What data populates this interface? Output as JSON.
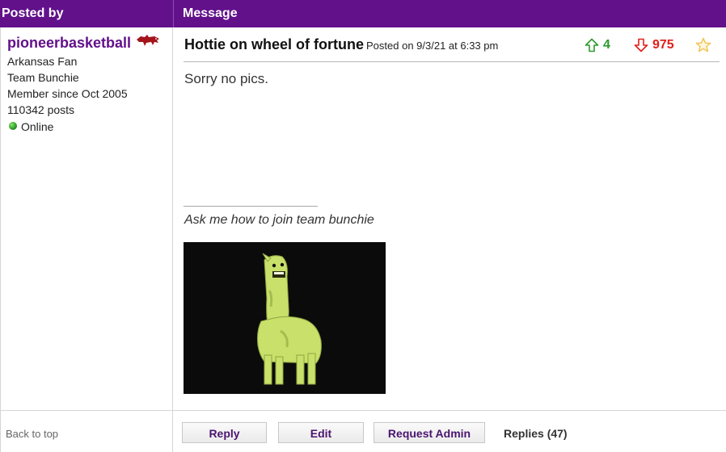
{
  "header": {
    "posted_by": "Posted by",
    "message": "Message"
  },
  "user": {
    "name": "pioneerbasketball",
    "fan": "Arkansas Fan",
    "team": "Team Bunchie",
    "member_since": "Member since Oct 2005",
    "posts": "110342 posts",
    "status": "Online",
    "status_color": "#2ea02a",
    "team_icon": "razorback-hog-icon"
  },
  "post": {
    "title": "Hottie on wheel of fortune",
    "posted_on": "Posted on 9/3/21 at 6:33 pm",
    "upvotes": "4",
    "downvotes": "975",
    "body": "Sorry no pics.",
    "signature_text": "Ask me how to join team bunchie"
  },
  "footer": {
    "back_to_top": "Back to top",
    "reply": "Reply",
    "edit": "Edit",
    "request_admin": "Request Admin",
    "replies": "Replies (47)"
  },
  "colors": {
    "header_bg": "#62118b",
    "upvote": "#2e9a2e",
    "downvote": "#e0201a",
    "star": "#f2c24c"
  }
}
